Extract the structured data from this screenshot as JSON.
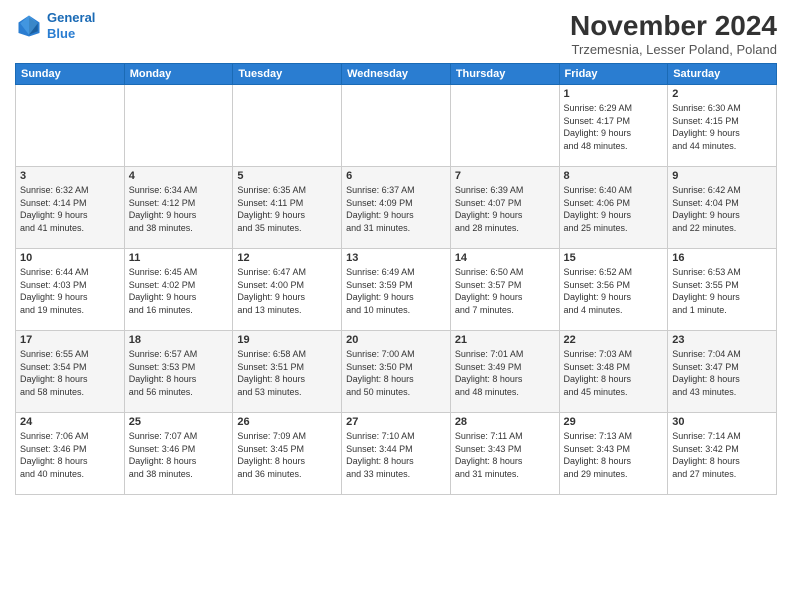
{
  "header": {
    "logo_line1": "General",
    "logo_line2": "Blue",
    "month": "November 2024",
    "location": "Trzemesnia, Lesser Poland, Poland"
  },
  "days_of_week": [
    "Sunday",
    "Monday",
    "Tuesday",
    "Wednesday",
    "Thursday",
    "Friday",
    "Saturday"
  ],
  "weeks": [
    [
      {
        "day": "",
        "info": ""
      },
      {
        "day": "",
        "info": ""
      },
      {
        "day": "",
        "info": ""
      },
      {
        "day": "",
        "info": ""
      },
      {
        "day": "",
        "info": ""
      },
      {
        "day": "1",
        "info": "Sunrise: 6:29 AM\nSunset: 4:17 PM\nDaylight: 9 hours\nand 48 minutes."
      },
      {
        "day": "2",
        "info": "Sunrise: 6:30 AM\nSunset: 4:15 PM\nDaylight: 9 hours\nand 44 minutes."
      }
    ],
    [
      {
        "day": "3",
        "info": "Sunrise: 6:32 AM\nSunset: 4:14 PM\nDaylight: 9 hours\nand 41 minutes."
      },
      {
        "day": "4",
        "info": "Sunrise: 6:34 AM\nSunset: 4:12 PM\nDaylight: 9 hours\nand 38 minutes."
      },
      {
        "day": "5",
        "info": "Sunrise: 6:35 AM\nSunset: 4:11 PM\nDaylight: 9 hours\nand 35 minutes."
      },
      {
        "day": "6",
        "info": "Sunrise: 6:37 AM\nSunset: 4:09 PM\nDaylight: 9 hours\nand 31 minutes."
      },
      {
        "day": "7",
        "info": "Sunrise: 6:39 AM\nSunset: 4:07 PM\nDaylight: 9 hours\nand 28 minutes."
      },
      {
        "day": "8",
        "info": "Sunrise: 6:40 AM\nSunset: 4:06 PM\nDaylight: 9 hours\nand 25 minutes."
      },
      {
        "day": "9",
        "info": "Sunrise: 6:42 AM\nSunset: 4:04 PM\nDaylight: 9 hours\nand 22 minutes."
      }
    ],
    [
      {
        "day": "10",
        "info": "Sunrise: 6:44 AM\nSunset: 4:03 PM\nDaylight: 9 hours\nand 19 minutes."
      },
      {
        "day": "11",
        "info": "Sunrise: 6:45 AM\nSunset: 4:02 PM\nDaylight: 9 hours\nand 16 minutes."
      },
      {
        "day": "12",
        "info": "Sunrise: 6:47 AM\nSunset: 4:00 PM\nDaylight: 9 hours\nand 13 minutes."
      },
      {
        "day": "13",
        "info": "Sunrise: 6:49 AM\nSunset: 3:59 PM\nDaylight: 9 hours\nand 10 minutes."
      },
      {
        "day": "14",
        "info": "Sunrise: 6:50 AM\nSunset: 3:57 PM\nDaylight: 9 hours\nand 7 minutes."
      },
      {
        "day": "15",
        "info": "Sunrise: 6:52 AM\nSunset: 3:56 PM\nDaylight: 9 hours\nand 4 minutes."
      },
      {
        "day": "16",
        "info": "Sunrise: 6:53 AM\nSunset: 3:55 PM\nDaylight: 9 hours\nand 1 minute."
      }
    ],
    [
      {
        "day": "17",
        "info": "Sunrise: 6:55 AM\nSunset: 3:54 PM\nDaylight: 8 hours\nand 58 minutes."
      },
      {
        "day": "18",
        "info": "Sunrise: 6:57 AM\nSunset: 3:53 PM\nDaylight: 8 hours\nand 56 minutes."
      },
      {
        "day": "19",
        "info": "Sunrise: 6:58 AM\nSunset: 3:51 PM\nDaylight: 8 hours\nand 53 minutes."
      },
      {
        "day": "20",
        "info": "Sunrise: 7:00 AM\nSunset: 3:50 PM\nDaylight: 8 hours\nand 50 minutes."
      },
      {
        "day": "21",
        "info": "Sunrise: 7:01 AM\nSunset: 3:49 PM\nDaylight: 8 hours\nand 48 minutes."
      },
      {
        "day": "22",
        "info": "Sunrise: 7:03 AM\nSunset: 3:48 PM\nDaylight: 8 hours\nand 45 minutes."
      },
      {
        "day": "23",
        "info": "Sunrise: 7:04 AM\nSunset: 3:47 PM\nDaylight: 8 hours\nand 43 minutes."
      }
    ],
    [
      {
        "day": "24",
        "info": "Sunrise: 7:06 AM\nSunset: 3:46 PM\nDaylight: 8 hours\nand 40 minutes."
      },
      {
        "day": "25",
        "info": "Sunrise: 7:07 AM\nSunset: 3:46 PM\nDaylight: 8 hours\nand 38 minutes."
      },
      {
        "day": "26",
        "info": "Sunrise: 7:09 AM\nSunset: 3:45 PM\nDaylight: 8 hours\nand 36 minutes."
      },
      {
        "day": "27",
        "info": "Sunrise: 7:10 AM\nSunset: 3:44 PM\nDaylight: 8 hours\nand 33 minutes."
      },
      {
        "day": "28",
        "info": "Sunrise: 7:11 AM\nSunset: 3:43 PM\nDaylight: 8 hours\nand 31 minutes."
      },
      {
        "day": "29",
        "info": "Sunrise: 7:13 AM\nSunset: 3:43 PM\nDaylight: 8 hours\nand 29 minutes."
      },
      {
        "day": "30",
        "info": "Sunrise: 7:14 AM\nSunset: 3:42 PM\nDaylight: 8 hours\nand 27 minutes."
      }
    ]
  ]
}
